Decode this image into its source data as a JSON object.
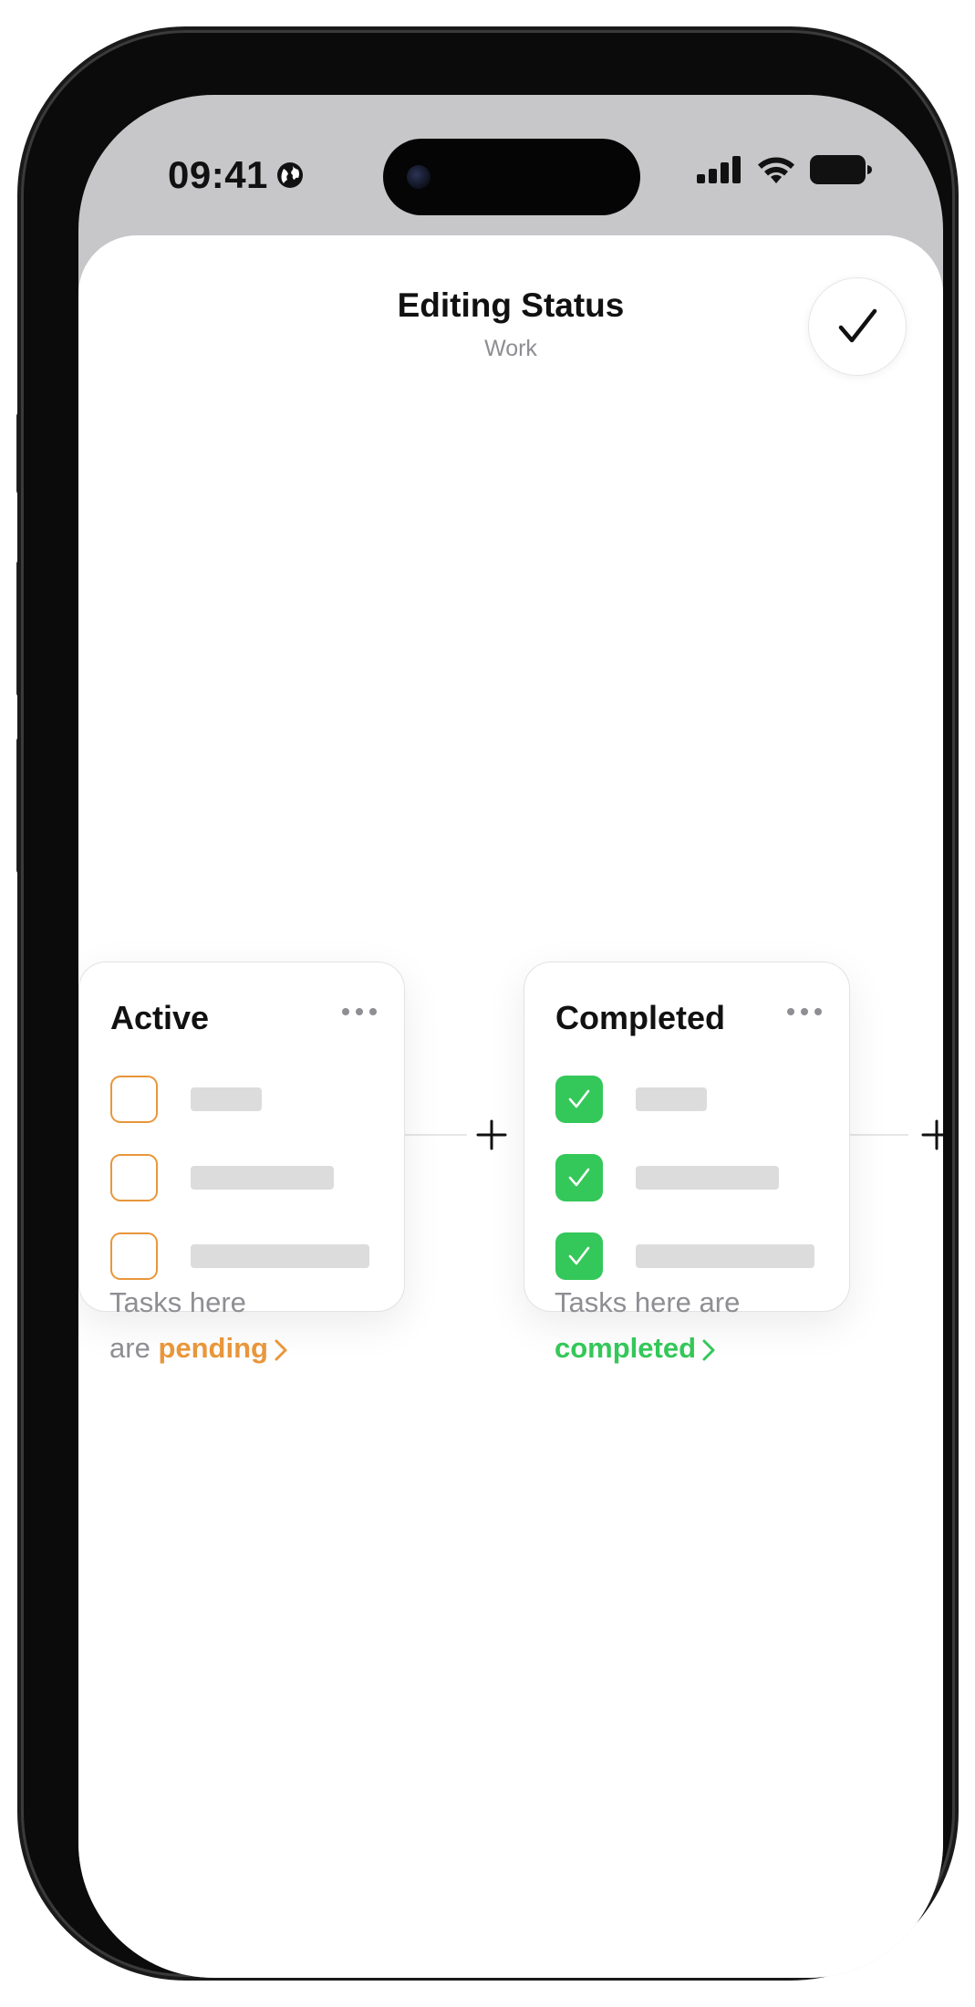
{
  "status_bar": {
    "time": "09:41",
    "icons": [
      "globe-icon",
      "cellular-signal-icon",
      "wifi-icon",
      "battery-icon"
    ]
  },
  "sheet": {
    "title": "Editing Status",
    "subtitle": "Work",
    "done_icon": "checkmark-icon"
  },
  "columns": [
    {
      "title": "Active",
      "kind": "pending",
      "color": "#E9963B",
      "caption_prefix": "Tasks here",
      "caption_prefix2": "are",
      "caption_link": "pending",
      "tasks": [
        {
          "done": false
        },
        {
          "done": false
        },
        {
          "done": false
        }
      ]
    },
    {
      "title": "Completed",
      "kind": "completed",
      "color": "#34C759",
      "caption_prefix": "Tasks here are",
      "caption_prefix2": "",
      "caption_link": "completed",
      "tasks": [
        {
          "done": true
        },
        {
          "done": true
        },
        {
          "done": true
        }
      ]
    }
  ],
  "colors": {
    "accent_pending": "#E9963B",
    "accent_completed": "#34C759",
    "secondary_text": "#8E8E93",
    "placeholder": "#DCDCDC"
  }
}
